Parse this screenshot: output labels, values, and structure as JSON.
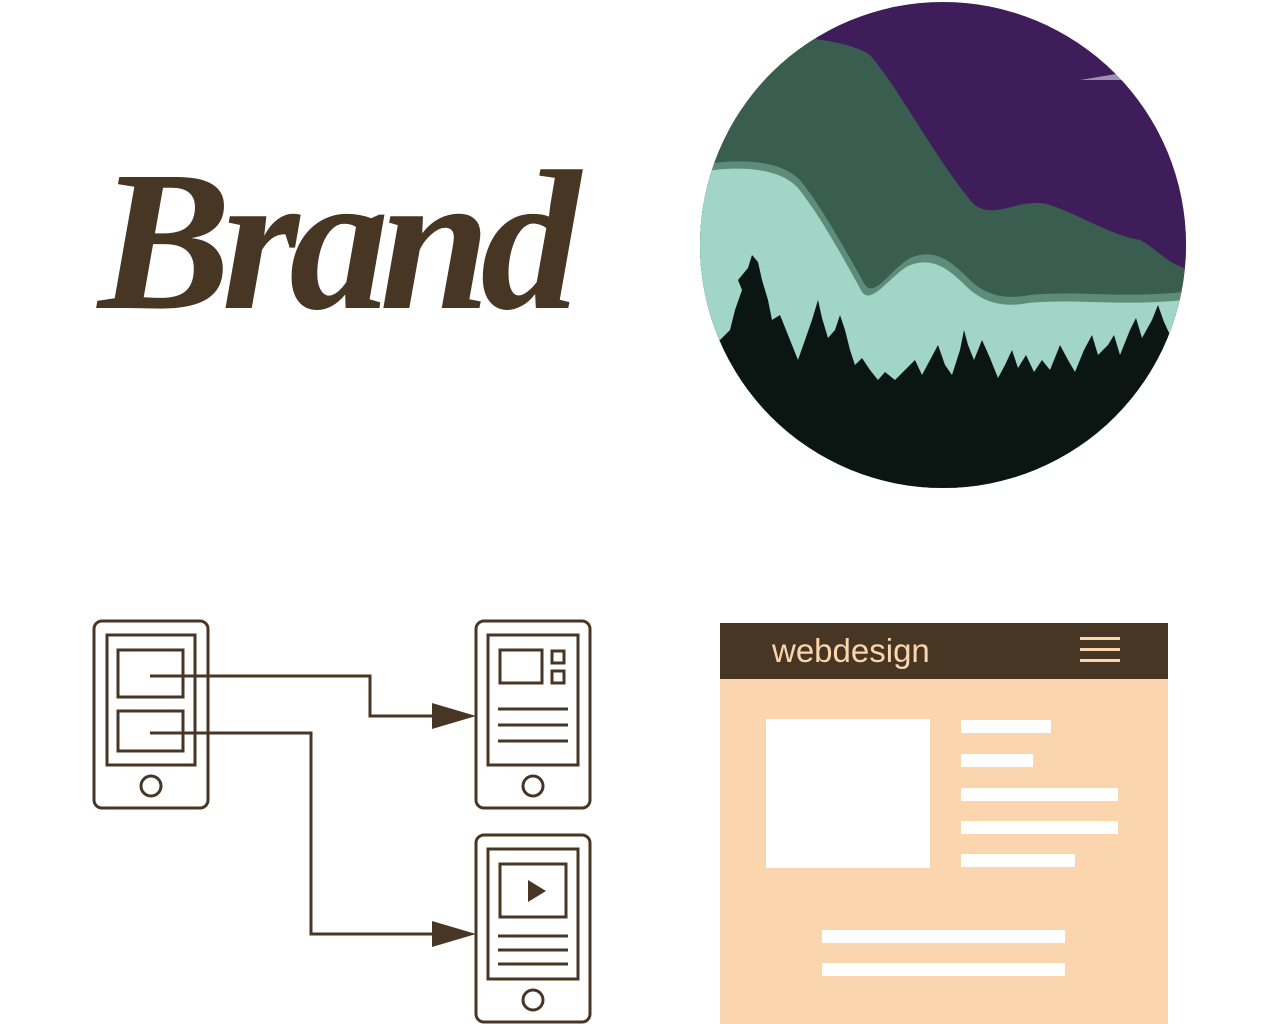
{
  "brand": {
    "wordmark": "Brand",
    "color": "#483625"
  },
  "logo": {
    "colors": {
      "sky": "#3e1d5a",
      "sky_glow": "#c9c2d6",
      "hill_dark": "#395e4f",
      "hill_mid": "#5d8c7b",
      "hill_light": "#a1d5c6",
      "trees": "#0b1512"
    }
  },
  "flow": {
    "line_color": "#483625",
    "icons": [
      "play-icon"
    ]
  },
  "web_mockup": {
    "title": "webdesign",
    "menu_icon": "hamburger-menu-icon",
    "colors": {
      "header": "#483625",
      "body": "#fad5ad",
      "blocks": "#ffffff"
    }
  }
}
